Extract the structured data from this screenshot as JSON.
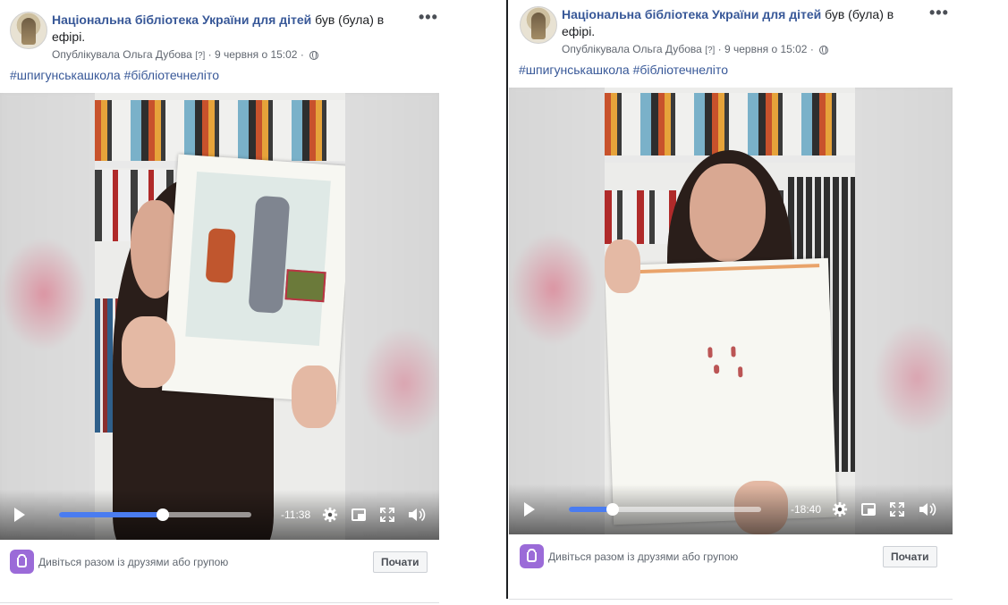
{
  "posts": [
    {
      "page_name": "Національна бібліотека України для дітей",
      "status": "був (була) в ефірі.",
      "published_by": "Опублікувала Ольга Дубова",
      "help": "[?]",
      "date": "9 червня о 15:02",
      "separator": "·",
      "more": "•••",
      "hashtags": [
        "#шпигунськашкола",
        "#бібліотечнелітo"
      ],
      "video": {
        "time_remaining": "-11:38",
        "progress": 0.54
      },
      "watch_together": "Дивіться разом із друзями або групою",
      "start_button": "Почати"
    },
    {
      "page_name": "Національна бібліотека України для дітей",
      "status": "був (була) в ефірі.",
      "published_by": "Опублікувала Ольга Дубова",
      "help": "[?]",
      "date": "9 червня о 15:02",
      "separator": "·",
      "more": "•••",
      "hashtags": [
        "#шпигунськашкола",
        "#бібліотечнелітo"
      ],
      "video": {
        "time_remaining": "-18:40",
        "progress": 0.23
      },
      "watch_together": "Дивіться разом із друзями або групою",
      "start_button": "Почати"
    }
  ],
  "colors": {
    "link": "#385898",
    "accent": "#4a7cf0",
    "watch_icon": "#9b6bd8"
  },
  "icons": [
    "play-icon",
    "settings-gear-icon",
    "picture-in-picture-icon",
    "fullscreen-icon",
    "volume-icon",
    "globe-icon",
    "watch-party-icon"
  ]
}
